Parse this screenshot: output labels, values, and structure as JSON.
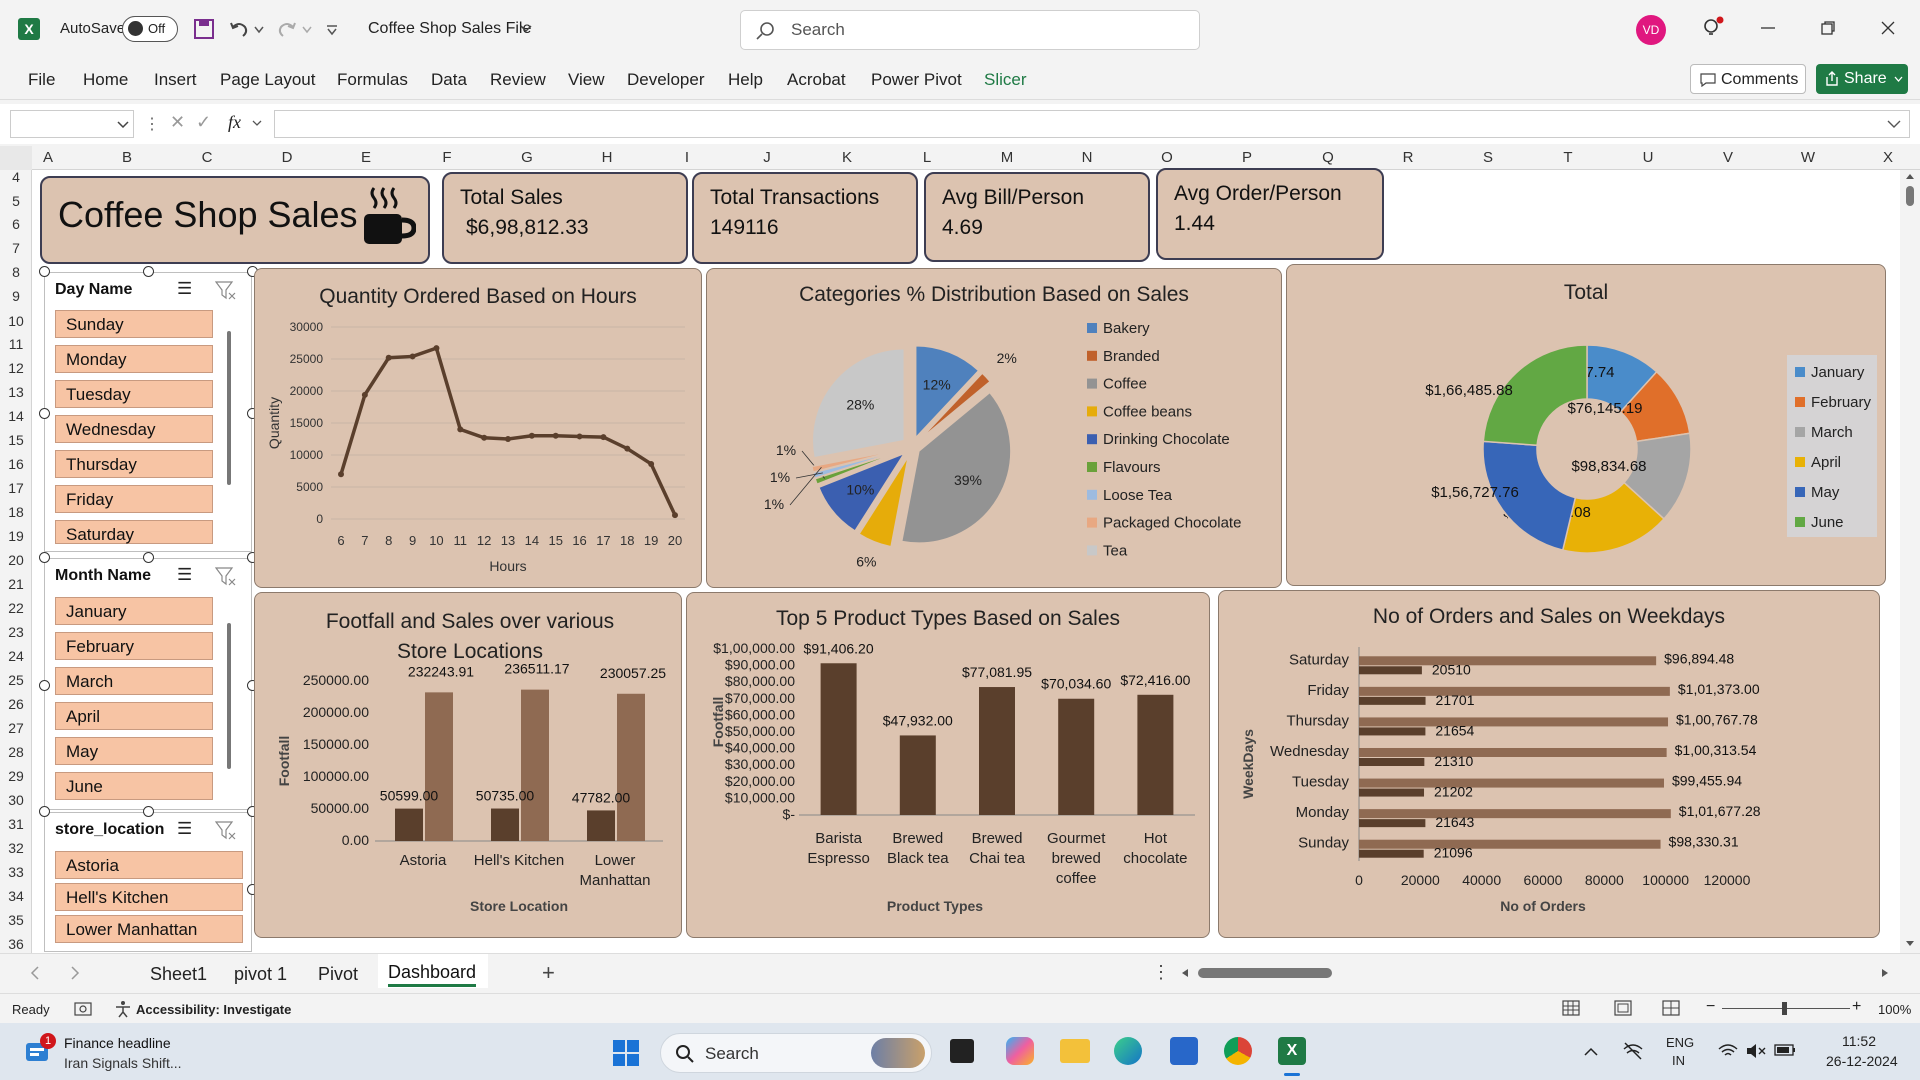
{
  "titlebar": {
    "autosave_label": "AutoSave",
    "autosave_state": "Off",
    "file_name": "Coffee Shop Sales File",
    "search_placeholder": "Search",
    "user_initials": "VD"
  },
  "ribbon": {
    "tabs": [
      "File",
      "Home",
      "Insert",
      "Page Layout",
      "Formulas",
      "Data",
      "Review",
      "View",
      "Developer",
      "Help",
      "Acrobat",
      "Power Pivot",
      "Slicer"
    ],
    "comments_label": "Comments",
    "share_label": "Share"
  },
  "formula_bar": {
    "fx": "fx"
  },
  "columns": [
    "A",
    "B",
    "C",
    "D",
    "E",
    "F",
    "G",
    "H",
    "I",
    "J",
    "K",
    "L",
    "M",
    "N",
    "O",
    "P",
    "Q",
    "R",
    "S",
    "T",
    "U",
    "V",
    "W",
    "X"
  ],
  "rows": [
    "4",
    "5",
    "6",
    "7",
    "8",
    "9",
    "10",
    "11",
    "12",
    "13",
    "14",
    "15",
    "16",
    "17",
    "18",
    "19",
    "20",
    "21",
    "22",
    "23",
    "24",
    "25",
    "26",
    "27",
    "28",
    "29",
    "30",
    "31",
    "32",
    "33",
    "34",
    "35",
    "36"
  ],
  "dashboard": {
    "title": "Coffee Shop Sales",
    "kpis": [
      {
        "title": "Total Sales",
        "value": "$6,98,812.33"
      },
      {
        "title": "Total Transactions",
        "value": "149116"
      },
      {
        "title": "Avg Bill/Person",
        "value": "4.69"
      },
      {
        "title": "Avg Order/Person",
        "value": "1.44"
      }
    ]
  },
  "slicers": {
    "day": {
      "header": "Day Name",
      "items": [
        "Sunday",
        "Monday",
        "Tuesday",
        "Wednesday",
        "Thursday",
        "Friday",
        "Saturday"
      ]
    },
    "month": {
      "header": "Month Name",
      "items": [
        "January",
        "February",
        "March",
        "April",
        "May",
        "June"
      ]
    },
    "store": {
      "header": "store_location",
      "items": [
        "Astoria",
        "Hell's Kitchen",
        "Lower Manhattan"
      ]
    }
  },
  "colors": {
    "card": "#dcc3b0",
    "brown_dark": "#5a3f2c",
    "brown_light": "#8f6a52",
    "slicer_item": "#f7c4a4",
    "excel_green": "#1f7a45"
  },
  "chart_data": [
    {
      "type": "line",
      "title": "Quantity Ordered Based on Hours",
      "xlabel": "Hours",
      "ylabel": "Quantity",
      "x": [
        6,
        7,
        8,
        9,
        10,
        11,
        12,
        13,
        14,
        15,
        16,
        17,
        18,
        19,
        20
      ],
      "values": [
        7000,
        19400,
        25200,
        25400,
        26700,
        14000,
        12700,
        12500,
        13000,
        13000,
        12900,
        12800,
        11000,
        8600,
        600
      ],
      "ylim": [
        0,
        30000
      ],
      "yticks": [
        "30000",
        "25000",
        "20000",
        "15000",
        "10000",
        "5000",
        "0"
      ]
    },
    {
      "type": "pie",
      "title": "Categories % Distribution Based on Sales",
      "labels": [
        "Bakery",
        "Branded",
        "Coffee",
        "Coffee beans",
        "Drinking Chocolate",
        "Flavours",
        "Loose Tea",
        "Packaged Chocolate",
        "Tea"
      ],
      "values": [
        12,
        2,
        39,
        6,
        10,
        1,
        1,
        1,
        28
      ],
      "data_labels": [
        "12%",
        "2%",
        "39%",
        "6%",
        "10%",
        "1%",
        "1%",
        "1%",
        "28%"
      ],
      "colors": [
        "#4f81bd",
        "#c0612b",
        "#939393",
        "#e6ac0a",
        "#3b5fb0",
        "#6aa13a",
        "#9dbbe0",
        "#e8a882",
        "#c8c8c8"
      ],
      "legend": "right"
    },
    {
      "type": "pie",
      "title": "Total",
      "labels": [
        "January",
        "February",
        "March",
        "April",
        "May",
        "June"
      ],
      "values": [
        81677.74,
        76145.19,
        98834.68,
        118941.08,
        156727.76,
        166485.88
      ],
      "data_labels": [
        "$81,677.74",
        "$76,145.19",
        "$98,834.68",
        "$1,18,941.08",
        "$1,56,727.76",
        "$1,66,485.88"
      ],
      "colors": [
        "#4a8cca",
        "#e06f2a",
        "#a5a5a5",
        "#e8b106",
        "#3766b8",
        "#62a844"
      ],
      "legend": "right"
    },
    {
      "type": "bar",
      "title": "Footfall and Sales over various Store Locations",
      "xlabel": "Store Location",
      "ylabel": "Footfall",
      "categories": [
        "Astoria",
        "Hell's Kitchen",
        "Lower Manhattan"
      ],
      "series": [
        {
          "values": [
            50599,
            50735,
            47782
          ]
        },
        {
          "values": [
            232243.91,
            236511.17,
            230057.25
          ]
        }
      ],
      "data_labels_1": [
        "50599.00",
        "50735.00",
        "47782.00"
      ],
      "data_labels_2": [
        "232243.91",
        "236511.17",
        "230057.25"
      ],
      "ylim": [
        0,
        250000
      ],
      "yticks": [
        "250000.00",
        "200000.00",
        "150000.00",
        "100000.00",
        "50000.00",
        "0.00"
      ]
    },
    {
      "type": "bar",
      "title": "Top 5 Product Types Based on Sales",
      "xlabel": "Product Types",
      "ylabel": "Footfall",
      "categories": [
        "Barista Espresso",
        "Brewed Black tea",
        "Brewed Chai tea",
        "Gourmet brewed coffee",
        "Hot chocolate"
      ],
      "values": [
        91406.2,
        47932.0,
        77081.95,
        70034.6,
        72416.0
      ],
      "data_labels": [
        "$91,406.20",
        "$47,932.00",
        "$77,081.95",
        "$70,034.60",
        "$72,416.00"
      ],
      "ylim": [
        0,
        100000
      ],
      "yticks": [
        "$1,00,000.00",
        "$90,000.00",
        "$80,000.00",
        "$70,000.00",
        "$60,000.00",
        "$50,000.00",
        "$40,000.00",
        "$30,000.00",
        "$20,000.00",
        "$10,000.00",
        "$-"
      ]
    },
    {
      "type": "bar",
      "title": "No of Orders and Sales on Weekdays",
      "xlabel": "No of Orders",
      "ylabel": "WeekDays",
      "categories": [
        "Saturday",
        "Friday",
        "Thursday",
        "Wednesday",
        "Tuesday",
        "Monday",
        "Sunday"
      ],
      "series": [
        {
          "values": [
            20510,
            21701,
            21654,
            21310,
            21202,
            21643,
            21096
          ]
        },
        {
          "values": [
            96894.48,
            101373.0,
            100767.78,
            100313.54,
            99455.94,
            101677.28,
            98330.31
          ]
        }
      ],
      "data_labels_1": [
        "20510",
        "21701",
        "21654",
        "21310",
        "21202",
        "21643",
        "21096"
      ],
      "data_labels_2": [
        "$96,894.48",
        "$1,01,373.00",
        "$1,00,767.78",
        "$1,00,313.54",
        "$99,455.94",
        "$1,01,677.28",
        "$98,330.31"
      ],
      "xlim": [
        0,
        120000
      ],
      "xticks": [
        "0",
        "20000",
        "40000",
        "60000",
        "80000",
        "100000",
        "120000"
      ]
    }
  ],
  "sheet_tabs": [
    "Sheet1",
    "pivot 1",
    "Pivot",
    "Dashboard"
  ],
  "statusbar": {
    "ready": "Ready",
    "accessibility": "Accessibility: Investigate",
    "zoom": "100%"
  },
  "taskbar": {
    "news_title": "Finance headline",
    "news_sub": "Iran Signals Shift...",
    "news_badge": "1",
    "search": "Search",
    "lang1": "ENG",
    "lang2": "IN",
    "time": "11:52",
    "date": "26-12-2024"
  }
}
